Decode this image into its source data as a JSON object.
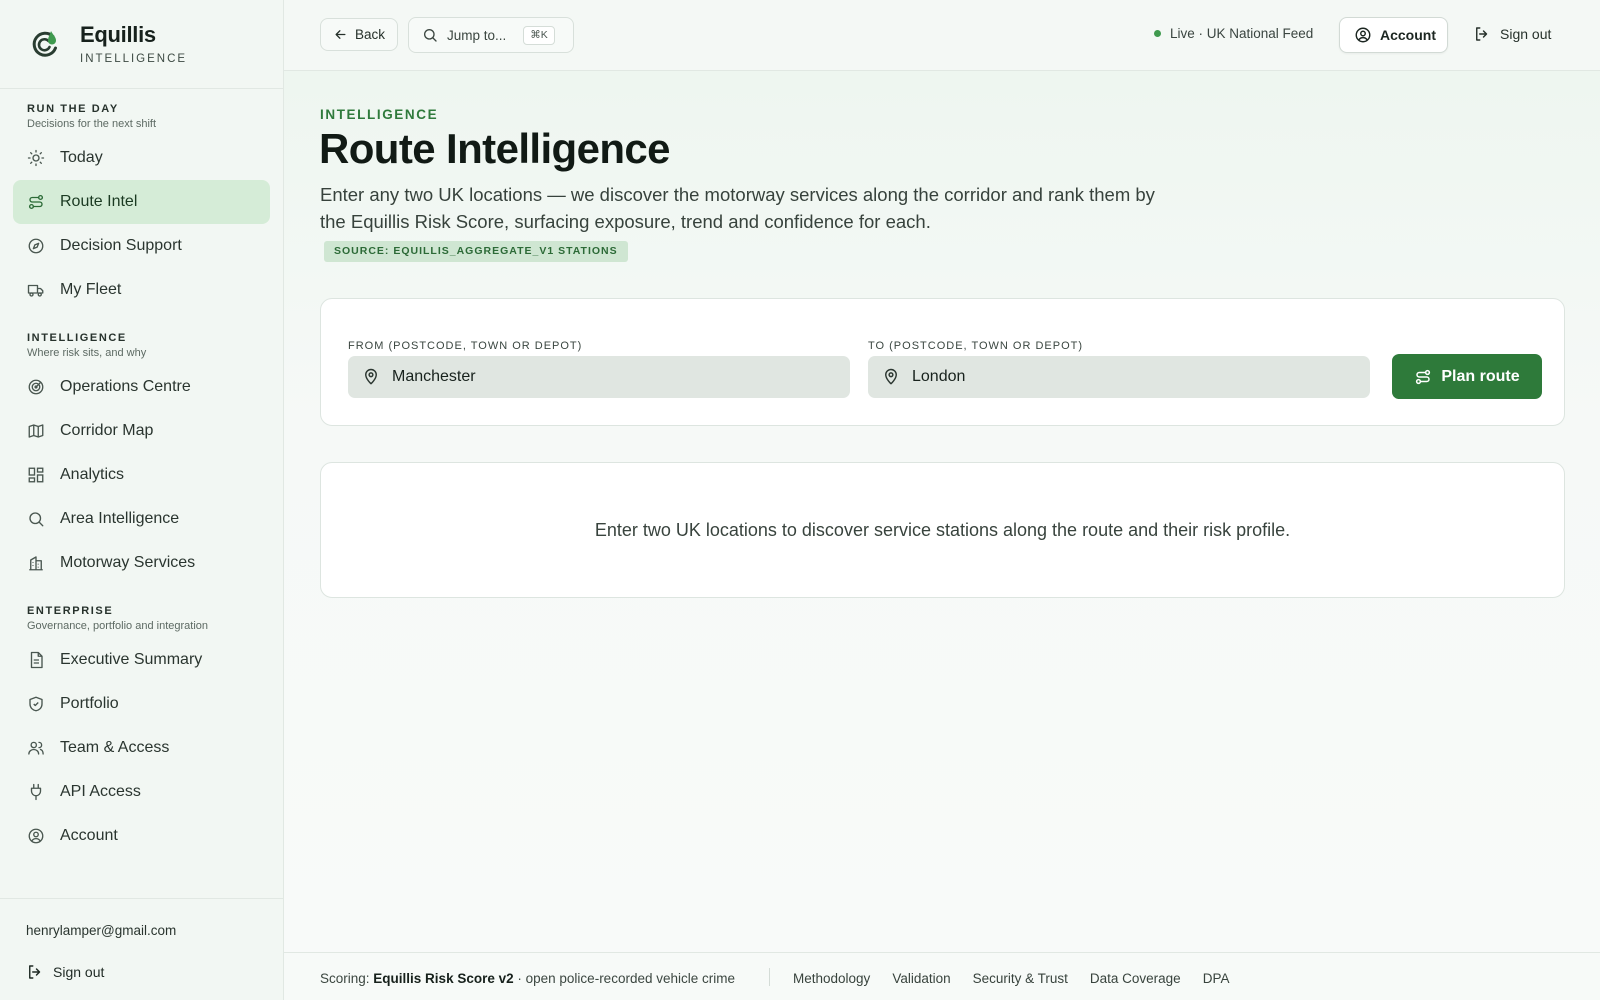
{
  "brand": {
    "name": "Equillis",
    "sub": "INTELLIGENCE",
    "logo_icon": "equillis-logo"
  },
  "sidebar": {
    "sections": [
      {
        "title": "RUN THE DAY",
        "subtitle": "Decisions for the next shift",
        "items": [
          {
            "label": "Today",
            "icon": "sun-icon"
          },
          {
            "label": "Route Intel",
            "icon": "route-icon",
            "active": true
          },
          {
            "label": "Decision Support",
            "icon": "compass-icon"
          },
          {
            "label": "My Fleet",
            "icon": "truck-icon"
          }
        ]
      },
      {
        "title": "INTELLIGENCE",
        "subtitle": "Where risk sits, and why",
        "items": [
          {
            "label": "Operations Centre",
            "icon": "radar-icon"
          },
          {
            "label": "Corridor Map",
            "icon": "map-icon"
          },
          {
            "label": "Analytics",
            "icon": "grid-icon"
          },
          {
            "label": "Area Intelligence",
            "icon": "search-icon"
          },
          {
            "label": "Motorway Services",
            "icon": "building-icon"
          }
        ]
      },
      {
        "title": "ENTERPRISE",
        "subtitle": "Governance, portfolio and integration",
        "items": [
          {
            "label": "Executive Summary",
            "icon": "document-icon"
          },
          {
            "label": "Portfolio",
            "icon": "shield-icon"
          },
          {
            "label": "Team & Access",
            "icon": "users-icon"
          },
          {
            "label": "API Access",
            "icon": "plug-icon"
          },
          {
            "label": "Account",
            "icon": "user-circle-icon"
          }
        ]
      }
    ],
    "user_email": "henrylamper@gmail.com",
    "signout_label": "Sign out"
  },
  "topbar": {
    "back_label": "Back",
    "jump_label": "Jump to...",
    "jump_shortcut": "⌘K",
    "live_label": "Live · UK National Feed",
    "account_label": "Account",
    "signout_label": "Sign out"
  },
  "page": {
    "eyebrow": "INTELLIGENCE",
    "title": "Route Intelligence",
    "description": "Enter any two UK locations — we discover the motorway services along the corridor and rank them by the Equillis Risk Score, surfacing exposure, trend and confidence for each.",
    "source_badge": "SOURCE: EQUILLIS_AGGREGATE_V1 STATIONS"
  },
  "form": {
    "from_label": "FROM (POSTCODE, TOWN OR DEPOT)",
    "from_value": "Manchester",
    "to_label": "TO (POSTCODE, TOWN OR DEPOT)",
    "to_value": "London",
    "plan_label": "Plan route"
  },
  "empty_state": "Enter two UK locations to discover service stations along the route and their risk profile.",
  "footer": {
    "scoring_prefix": "Scoring:",
    "scoring_name": "Equillis Risk Score v2",
    "scoring_suffix": "· open police-recorded vehicle crime",
    "links": [
      "Methodology",
      "Validation",
      "Security & Trust",
      "Data Coverage",
      "DPA"
    ]
  },
  "colors": {
    "accent": "#2e7a3a",
    "active_bg": "#d5ecd7",
    "badge_bg": "#cfe6d2",
    "live_dot": "#3f9a4e"
  }
}
